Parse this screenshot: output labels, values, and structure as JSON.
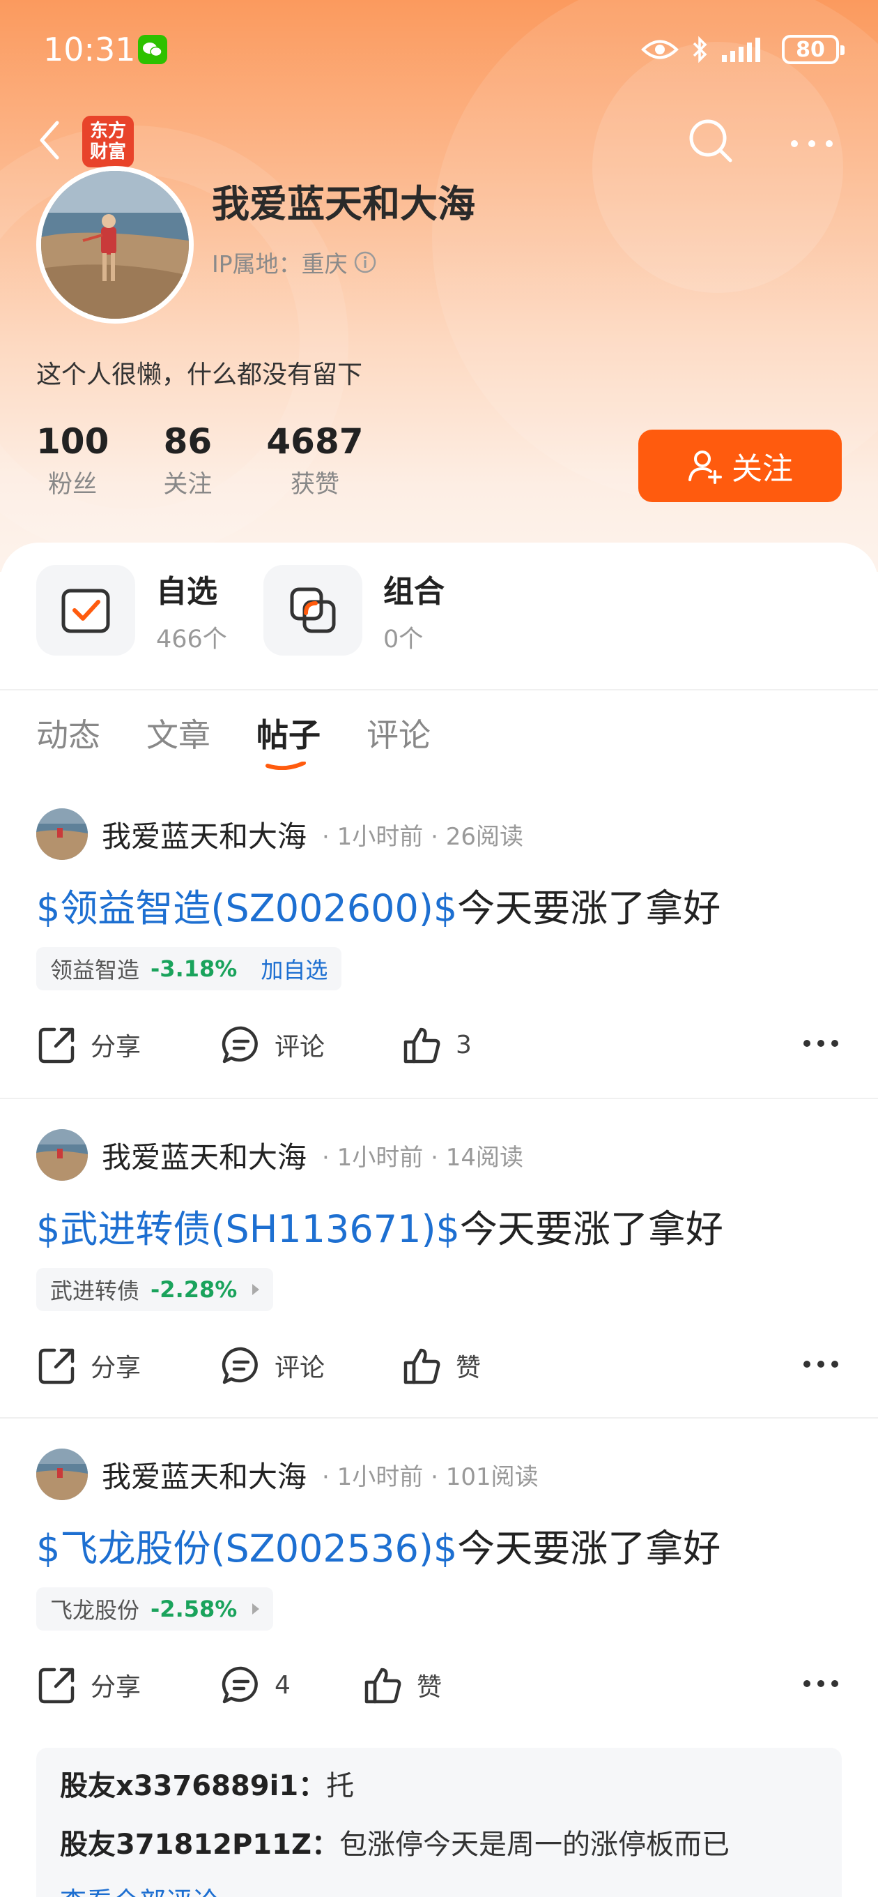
{
  "status_bar": {
    "time": "10:31",
    "battery": "80"
  },
  "nav": {
    "logo_line1": "东方",
    "logo_line2": "财富"
  },
  "profile": {
    "username": "我爱蓝天和大海",
    "ip_location": "IP属地：重庆",
    "bio": "这个人很懒，什么都没有留下",
    "stats": [
      {
        "value": "100",
        "label": "粉丝"
      },
      {
        "value": "86",
        "label": "关注"
      },
      {
        "value": "4687",
        "label": "获赞"
      }
    ],
    "follow_label": "关注"
  },
  "quick_links": [
    {
      "title": "自选",
      "subtitle": "466个"
    },
    {
      "title": "组合",
      "subtitle": "0个"
    }
  ],
  "tabs": [
    {
      "label": "动态",
      "active": false
    },
    {
      "label": "文章",
      "active": false
    },
    {
      "label": "帖子",
      "active": true
    },
    {
      "label": "评论",
      "active": false
    }
  ],
  "posts": [
    {
      "author": "我爱蓝天和大海",
      "time": "1小时前",
      "reads": "26阅读",
      "stock_link": "$领益智造(SZ002600)$",
      "title_rest": "今天要涨了拿好",
      "chip_name": "领益智造",
      "chip_pct": "-3.18%",
      "chip_action": "加自选",
      "share_label": "分享",
      "comment_label": "评论",
      "like_label": "3"
    },
    {
      "author": "我爱蓝天和大海",
      "time": "1小时前",
      "reads": "14阅读",
      "stock_link": "$武进转债(SH113671)$",
      "title_rest": "今天要涨了拿好",
      "chip_name": "武进转债",
      "chip_pct": "-2.28%",
      "share_label": "分享",
      "comment_label": "评论",
      "like_label": "赞"
    },
    {
      "author": "我爱蓝天和大海",
      "time": "1小时前",
      "reads": "101阅读",
      "stock_link": "$飞龙股份(SZ002536)$",
      "title_rest": "今天要涨了拿好",
      "chip_name": "飞龙股份",
      "chip_pct": "-2.58%",
      "share_label": "分享",
      "comment_label": "4",
      "like_label": "赞",
      "comments": [
        {
          "user": "股友x3376889i1：",
          "text": "托"
        },
        {
          "user": "股友371812P11Z：",
          "text": "包涨停今天是周一的涨停板而已"
        }
      ],
      "view_all": "查看全部评论 ›"
    }
  ],
  "colors": {
    "accent_orange": "#ff5b0e",
    "link_blue": "#1d6fd1",
    "down_green": "#1aa35c"
  }
}
